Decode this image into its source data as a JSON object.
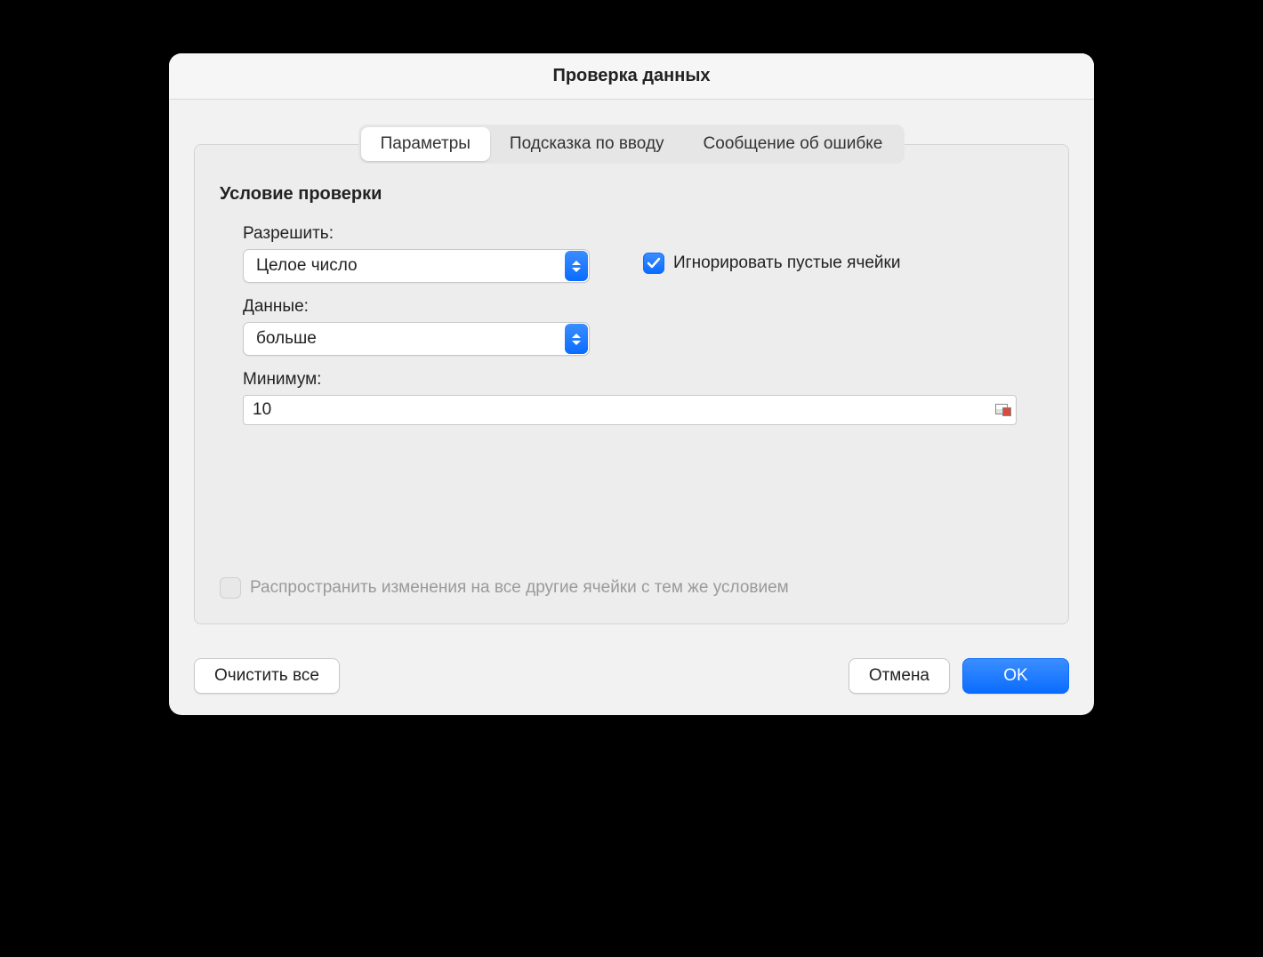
{
  "dialog": {
    "title": "Проверка данных"
  },
  "tabs": {
    "settings": "Параметры",
    "input_hint": "Подсказка по вводу",
    "error_msg": "Сообщение об ошибке"
  },
  "panel": {
    "section_title": "Условие проверки",
    "allow_label": "Разрешить:",
    "allow_value": "Целое число",
    "ignore_blank_label": "Игнорировать пустые ячейки",
    "ignore_blank_checked": true,
    "data_label": "Данные:",
    "data_value": "больше",
    "minimum_label": "Минимум:",
    "minimum_value": "10",
    "propagate_label": "Распространить изменения на все другие ячейки с тем же условием",
    "propagate_checked": false,
    "propagate_enabled": false
  },
  "footer": {
    "clear_all": "Очистить все",
    "cancel": "Отмена",
    "ok": "OK"
  }
}
